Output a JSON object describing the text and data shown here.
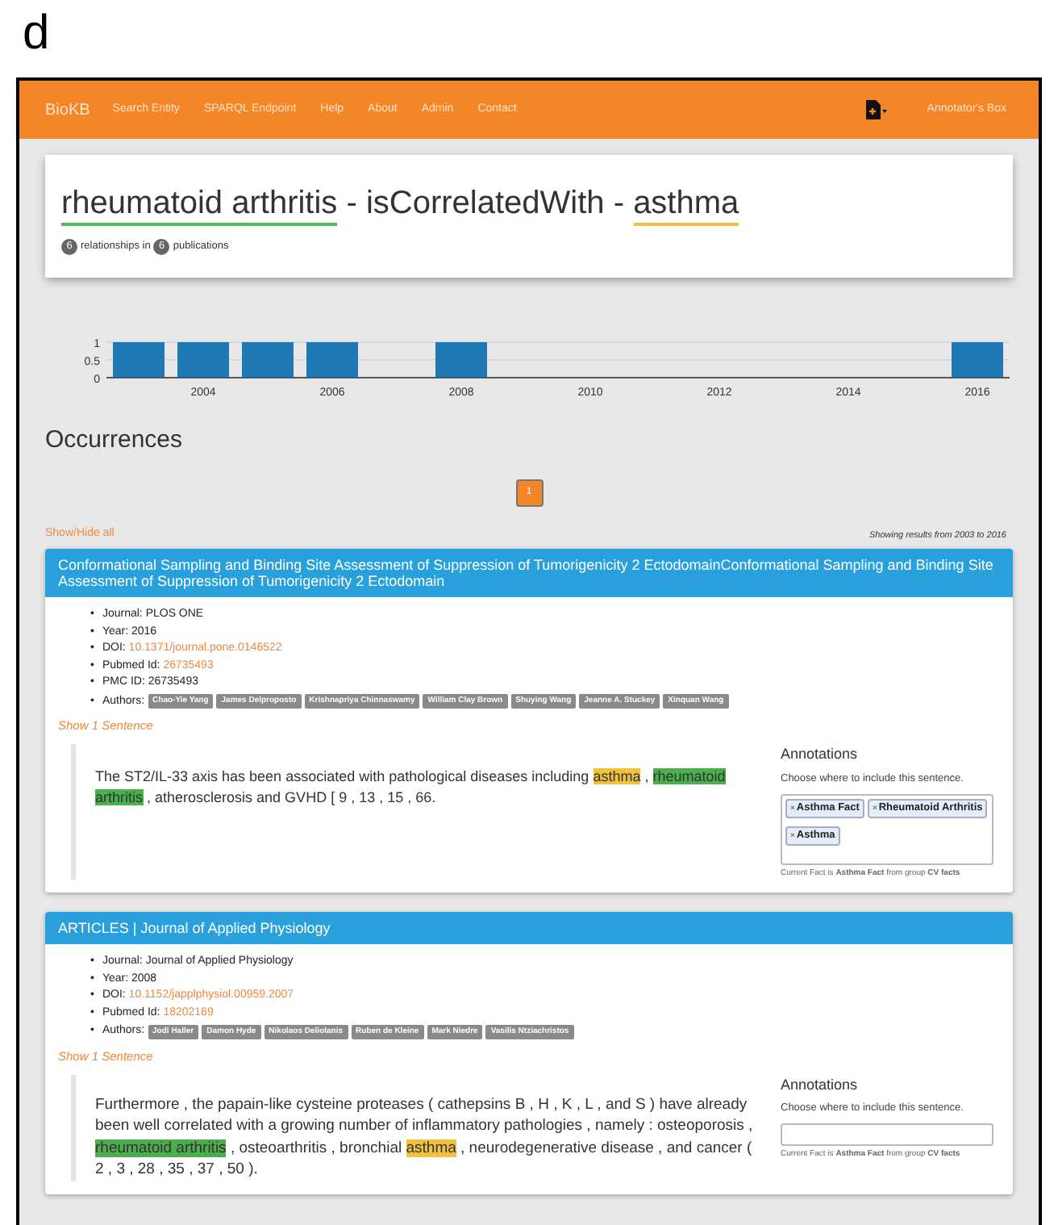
{
  "figure_label": "d",
  "navbar": {
    "brand": "BioKB",
    "links": [
      "Search Entity",
      "SPARQL Endpoint",
      "Help",
      "About",
      "Admin",
      "Contact"
    ],
    "right_link": "Annotator's Box"
  },
  "header": {
    "subject": "rheumatoid arthritis",
    "separator1": " - isCorrelatedWith - ",
    "object": "asthma",
    "relationship_count": "6",
    "relationships_text": "relationships in",
    "publication_count": "6",
    "publications_text": "publications"
  },
  "chart_data": {
    "type": "bar",
    "x": [
      2003,
      2004,
      2005,
      2006,
      2008,
      2016
    ],
    "series": [
      {
        "color": "#1f77b4",
        "values": [
          1,
          1,
          1,
          1,
          1,
          1
        ]
      }
    ],
    "xlim": [
      2002.5,
      2016.5
    ],
    "ylim": [
      0,
      1
    ],
    "yticks": [
      0,
      0.5,
      1
    ],
    "xticks": [
      {
        "value": 2004,
        "label": "2004"
      },
      {
        "value": 2006,
        "label": "2006"
      },
      {
        "value": 2008,
        "label": "2008"
      },
      {
        "value": 2010,
        "label": "2010"
      },
      {
        "value": 2012,
        "label": "2012"
      },
      {
        "value": 2014,
        "label": "2014"
      },
      {
        "value": 2016,
        "label": "2016"
      }
    ]
  },
  "occurrences": {
    "title": "Occurrences",
    "pages": [
      {
        "label": "1",
        "selected": true
      }
    ],
    "show_hide": "Show/Hide all",
    "range_text": "Showing results from 2003 to 2016"
  },
  "articles": [
    {
      "title": "Conformational Sampling and Binding Site Assessment of Suppression of Tumorigenicity 2 EctodomainConformational Sampling and Binding Site Assessment of Suppression of Tumorigenicity 2 Ectodomain",
      "details": [
        {
          "bullet": "•",
          "label": "Journal: ",
          "value": "PLOS ONE",
          "kind": "text"
        },
        {
          "bullet": "•",
          "label": "Year: ",
          "value": "2016",
          "kind": "text"
        },
        {
          "bullet": "•",
          "label": "DOI: ",
          "value": "10.1371/journal.pone.0146522",
          "kind": "link"
        },
        {
          "bullet": "•",
          "label": "Pubmed Id: ",
          "value": "26735493",
          "kind": "link"
        },
        {
          "bullet": "•",
          "label": "PMC ID: ",
          "value": "26735493",
          "kind": "text"
        }
      ],
      "authors_bullet": "•",
      "authors_label": "Authors: ",
      "authors": [
        "Chao-Yie Yang",
        "James Delproposto",
        "Krishnapriya Chinnaswamy",
        "William Clay Brown",
        "Shuying Wang",
        "Jeanne A. Stuckey",
        "Xinquan Wang"
      ],
      "show_sentence": "Show 1 Sentence",
      "sentence": [
        {
          "text": "The ST2/IL-33 axis has been associated with pathological diseases including "
        },
        {
          "text": "asthma",
          "color": "#f0c040"
        },
        {
          "text": " , "
        },
        {
          "text": "rheumatoid arthritis",
          "color": "#4cae4c"
        },
        {
          "text": " , atherosclerosis and GVHD [ 9 , 13 , 15 , 66."
        }
      ],
      "annotations": {
        "title": "Annotations",
        "hint": "Choose where to include this sentence.",
        "tags": [
          {
            "remove": "×",
            "label": "Asthma Fact"
          },
          {
            "remove": "×",
            "label": "Rheumatoid Arthritis"
          },
          {
            "remove": "×",
            "label": "Asthma"
          }
        ],
        "current": "Current Fact is **Asthma Fact** from group **CV facts**"
      }
    },
    {
      "title": "ARTICLES | Journal of Applied Physiology",
      "details": [
        {
          "bullet": "•",
          "label": "Journal: ",
          "value": "Journal of Applied Physiology",
          "kind": "text"
        },
        {
          "bullet": "•",
          "label": "Year: ",
          "value": "2008",
          "kind": "text"
        },
        {
          "bullet": "•",
          "label": "DOI: ",
          "value": "10.1152/japplphysiol.00959.2007",
          "kind": "link"
        },
        {
          "bullet": "•",
          "label": "Pubmed Id: ",
          "value": "18202169",
          "kind": "link"
        }
      ],
      "authors_bullet": "•",
      "authors_label": "Authors: ",
      "authors": [
        "Jodi Haller",
        "Damon Hyde",
        "Nikolaos Deliolanis",
        "Ruben de Kleine",
        "Mark Niedre",
        "Vasilis Ntziachristos"
      ],
      "show_sentence": "Show 1 Sentence",
      "sentence": [
        {
          "text": "Furthermore , the papain-like cysteine proteases ( cathepsins B , H , K , L , and S ) have already been well correlated with a growing number of inflammatory pathologies , namely : osteoporosis , "
        },
        {
          "text": "rheumatoid arthritis",
          "color": "#4cae4c"
        },
        {
          "text": " , osteoarthritis , bronchial "
        },
        {
          "text": "asthma",
          "color": "#f0c040"
        },
        {
          "text": " , neurodegenerative disease , and cancer ( 2 , 3 , 28 , 35 , 37 , 50 )."
        }
      ],
      "annotations": {
        "title": "Annotations",
        "hint": "Choose where to include this sentence.",
        "current": "Current Fact is **Asthma Fact** from group **CV facts**"
      }
    }
  ]
}
